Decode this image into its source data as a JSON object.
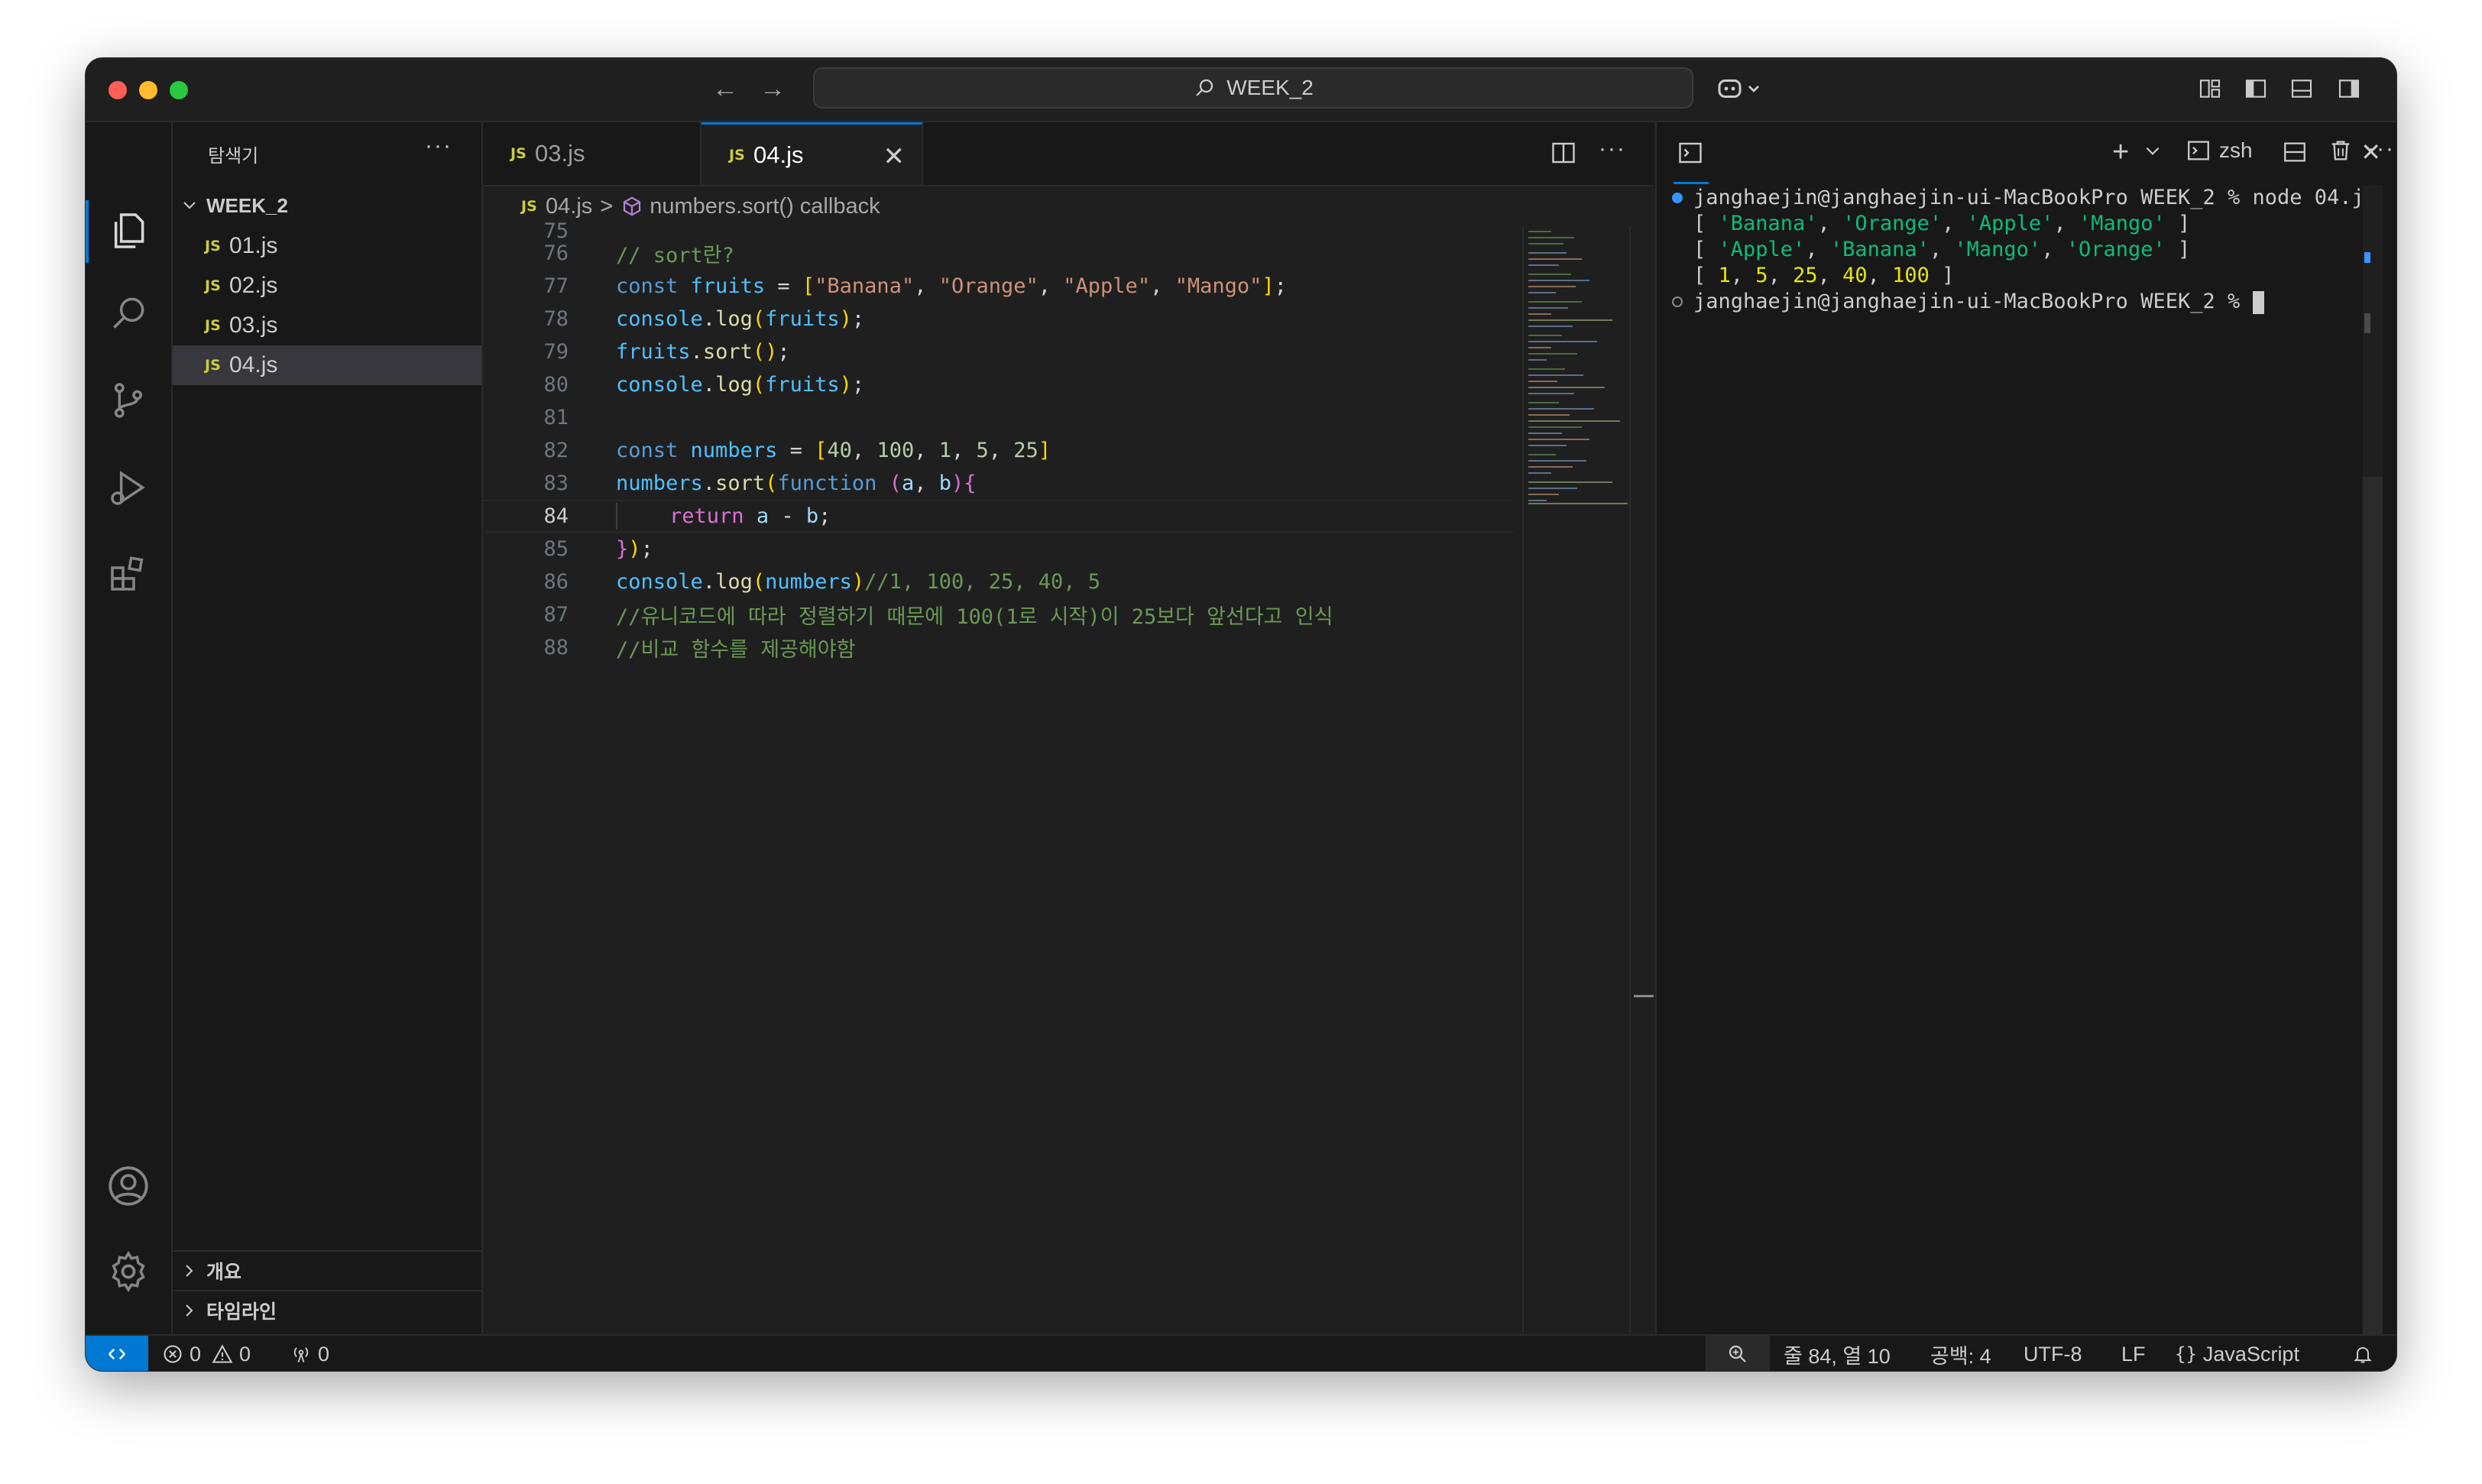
{
  "titlebar": {
    "search_text": "WEEK_2"
  },
  "sidebar": {
    "title": "탐색기",
    "more": "···",
    "folder": "WEEK_2",
    "files": [
      {
        "badge": "JS",
        "name": "01.js"
      },
      {
        "badge": "JS",
        "name": "02.js"
      },
      {
        "badge": "JS",
        "name": "03.js"
      },
      {
        "badge": "JS",
        "name": "04.js"
      }
    ],
    "outline": "개요",
    "timeline": "타임라인"
  },
  "editor": {
    "tabs": [
      {
        "badge": "JS",
        "label": "03.js"
      },
      {
        "badge": "JS",
        "label": "04.js"
      }
    ],
    "breadcrumb": {
      "badge": "JS",
      "file": "04.js",
      "separator": ">",
      "symbol": "numbers.sort() callback"
    },
    "line_numbers": [
      "75",
      "76",
      "77",
      "78",
      "79",
      "80",
      "81",
      "82",
      "83",
      "84",
      "85",
      "86",
      "87",
      "88"
    ],
    "comments": {
      "l76": "// sort란?",
      "l86": "//1, 100, 25, 40, 5",
      "l87": "//유니코드에 따라 정렬하기 때문에 100(1로 시작)이 25보다 앞선다고 인식",
      "l88": "//비교 함수를 제공해야함"
    }
  },
  "terminal": {
    "shell": "zsh",
    "prompt": "janghaejin@janghaejin-ui-MacBookPro WEEK_2 % ",
    "command": "node 04.js",
    "output_strings": [
      "'Banana'",
      "'Orange'",
      "'Apple'",
      "'Mango'"
    ],
    "output_sorted": [
      "'Apple'",
      "'Banana'",
      "'Mango'",
      "'Orange'"
    ],
    "output_numbers": [
      "1",
      "5",
      "25",
      "40",
      "100"
    ]
  },
  "statusbar": {
    "errors": "0",
    "warnings": "0",
    "ports": "0",
    "position": "줄 84, 열 10",
    "spaces": "공백: 4",
    "encoding": "UTF-8",
    "eol": "LF",
    "language": "JavaScript"
  },
  "colors": {
    "accent": "#0078d4",
    "editor_bg": "#1f1f1f",
    "sidebar_bg": "#181818",
    "js_badge": "#cbcb41"
  }
}
